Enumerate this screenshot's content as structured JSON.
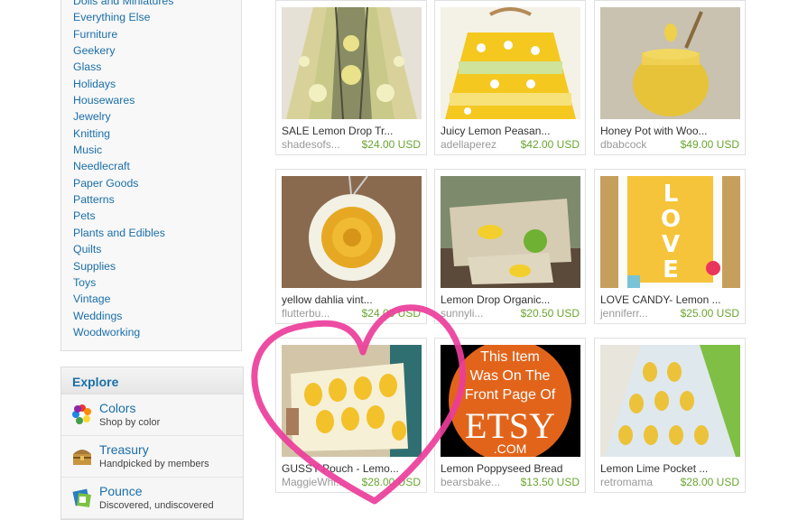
{
  "categories": [
    "Dolls and Miniatures",
    "Everything Else",
    "Furniture",
    "Geekery",
    "Glass",
    "Holidays",
    "Housewares",
    "Jewelry",
    "Knitting",
    "Music",
    "Needlecraft",
    "Paper Goods",
    "Patterns",
    "Pets",
    "Plants and Edibles",
    "Quilts",
    "Supplies",
    "Toys",
    "Vintage",
    "Weddings",
    "Woodworking"
  ],
  "explore": {
    "heading": "Explore",
    "items": [
      {
        "title": "Colors",
        "subtitle": "Shop by color",
        "icon": "color-wheel-icon"
      },
      {
        "title": "Treasury",
        "subtitle": "Handpicked by members",
        "icon": "treasure-chest-icon"
      },
      {
        "title": "Pounce",
        "subtitle": "Discovered, undiscovered",
        "icon": "pounce-icon"
      }
    ]
  },
  "items": [
    {
      "title": "SALE Lemon Drop Tr...",
      "shop": "shadesofs...",
      "price": "$24.00 USD",
      "image": "lampshade"
    },
    {
      "title": "Juicy Lemon Peasan...",
      "shop": "adellaperez",
      "price": "$42.00 USD",
      "image": "dress"
    },
    {
      "title": "Honey Pot with Woo...",
      "shop": "dbabcock",
      "price": "$49.00 USD",
      "image": "honeypot"
    },
    {
      "title": "yellow dahlia vint...",
      "shop": "flutterbu...",
      "price": "$24.00 USD",
      "image": "pendant"
    },
    {
      "title": "Lemon Drop Organic...",
      "shop": "sunnyli...",
      "price": "$20.50 USD",
      "image": "pouches"
    },
    {
      "title": "LOVE CANDY- Lemon ...",
      "shop": "jenniferr...",
      "price": "$25.00 USD",
      "image": "love-print"
    },
    {
      "title": "GUSSY Pouch - Lemo...",
      "shop": "MaggieWhi...",
      "price": "$28.00 USD",
      "image": "lemon-pouch"
    },
    {
      "title": "Lemon Poppyseed Bread",
      "shop": "bearsbake...",
      "price": "$13.50 USD",
      "image": "front-page-badge"
    },
    {
      "title": "Lemon Lime Pocket ...",
      "shop": "retromama",
      "price": "$28.00 USD",
      "image": "lemon-apron"
    }
  ],
  "badge_text": [
    "This Item",
    "Was On The",
    "Front Page Of",
    "ETSY",
    ".COM"
  ],
  "colors": {
    "link": "#1a6fa8",
    "price": "#6aa531",
    "shop": "#999999",
    "heart": "#ec3d9b"
  }
}
